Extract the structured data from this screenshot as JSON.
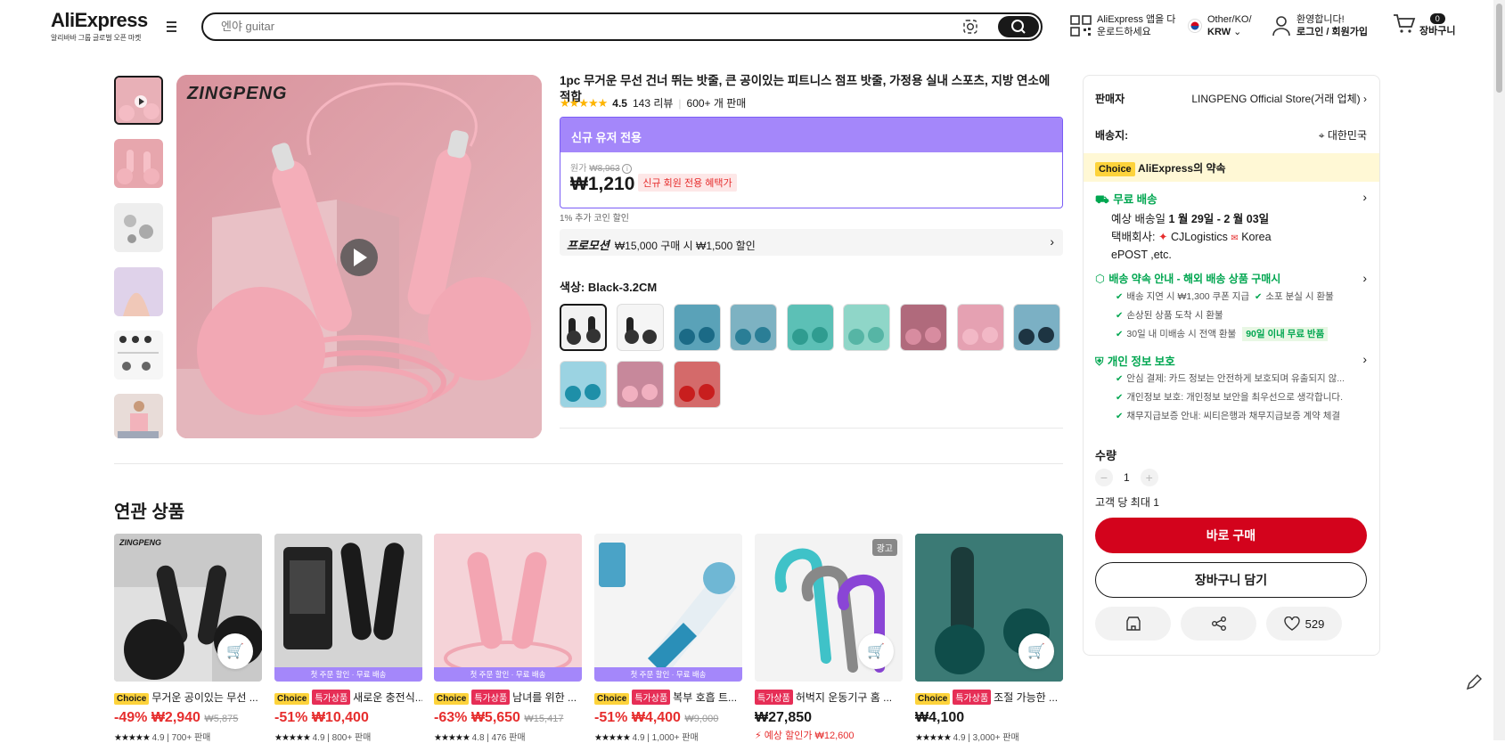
{
  "header": {
    "logo": "AliExpress",
    "logo_sub": "알리바바 그룹 글로벌 오픈 마켓",
    "search_placeholder": "엔야 guitar",
    "app_line1": "AliExpress 앱을 다",
    "app_line2": "운로드하세요",
    "region_line1": "Other/KO/",
    "region_line2": "KRW",
    "account_line1": "환영합니다!",
    "account_line2": "로그인 / 회원가입",
    "cart_count": "0",
    "cart_label": "장바구니"
  },
  "product": {
    "title": "1pc 무거운 무선 건너 뛰는 밧줄, 큰 공이있는 피트니스 점프 밧줄, 가정용 실내 스포츠, 지방 연소에 적합",
    "rating": "4.5",
    "reviews": "143 리뷰",
    "sold": "600+ 개 판매",
    "new_user_banner": "신규 유저 전용",
    "orig_label": "원가",
    "orig_price": "₩8,963",
    "price": "₩1,210",
    "price_tag": "신규 회원 전용 혜택가",
    "coin_note": "1% 추가 코인 할인",
    "promo_label": "프로모션",
    "promo_text": "₩15,000 구매 시 ₩1,500 할인",
    "color_label": "색상:",
    "color_value": "Black-3.2CM",
    "brand_watermark": "ZINGPENG"
  },
  "panel": {
    "seller_label": "판매자",
    "seller_value": "LINGPENG Official Store(거래 업체)",
    "ship_label": "배송지:",
    "ship_value": "대한민국",
    "choice_tag": "Choice",
    "choice_promise": "AliExpress의 약속",
    "free_ship": "무료 배송",
    "eta_prefix": "예상 배송일",
    "eta": "1 월 29일 - 2 월 03일",
    "carrier_label": "택배회사:",
    "carrier1": "CJLogistics",
    "carrier2": "Korea",
    "carrier3": "ePOST ,etc.",
    "promise_title": "배송 약속 안내 - 해외 배송 상품 구매시",
    "promise_items": [
      "배송 지연 시 ₩1,300 쿠폰 지급",
      "소포 분실 시 환불",
      "손상된 상품 도착 시 환불",
      "30일 내 미배송 시 전액 환불"
    ],
    "return_tag": "90일 이내 무료 반품",
    "privacy_title": "개인 정보 보호",
    "privacy_items": [
      "안심 결제: 카드 정보는 안전하게 보호되며 유출되지 않...",
      "개인정보 보호: 개인정보 보안을 최우선으로 생각합니다.",
      "채무지급보증 안내: 씨티은행과 채무지급보증 계약 체결"
    ],
    "qty_label": "수량",
    "qty": "1",
    "limit": "고객 당 최대 1",
    "buy_now": "바로 구매",
    "add_cart": "장바구니 담기",
    "wish_count": "529"
  },
  "related": {
    "title": "연관 상품",
    "items": [
      {
        "choice": "Choice",
        "tag": "",
        "title": "무거운 공이있는 무선 ...",
        "disc": "-49%",
        "price": "₩2,940",
        "orig": "₩5,875",
        "meta": "4.9 | 700+ 판매",
        "banner": "",
        "ad": "",
        "brand": "ZINGPENG"
      },
      {
        "choice": "Choice",
        "tag": "특가상품",
        "title": "새로운 충전식...",
        "disc": "-51%",
        "price": "₩10,400",
        "orig": "",
        "meta": "4.9 | 800+ 판매",
        "banner": "첫 주문 할인 · 무료 배송",
        "ad": "",
        "brand": ""
      },
      {
        "choice": "Choice",
        "tag": "특가상품",
        "title": "남녀를 위한 ...",
        "disc": "-63%",
        "price": "₩5,650",
        "orig": "₩15,417",
        "meta": "4.8 | 476 판매",
        "banner": "첫 주문 할인 · 무료 배송",
        "ad": "",
        "brand": ""
      },
      {
        "choice": "Choice",
        "tag": "특가상품",
        "title": "복부 호흡 트...",
        "disc": "-51%",
        "price": "₩4,400",
        "orig": "₩9,000",
        "meta": "4.9 | 1,000+ 판매",
        "banner": "첫 주문 할인 · 무료 배송",
        "ad": "",
        "brand": ""
      },
      {
        "choice": "",
        "tag": "특가상품",
        "title": "허벅지 운동기구 홈 ...",
        "disc": "",
        "price": "₩27,850",
        "orig": "",
        "meta": "",
        "banner": "",
        "ad": "광고",
        "brand": "",
        "sale": "예상 할인가 ₩12,600"
      },
      {
        "choice": "Choice",
        "tag": "특가상품",
        "title": "조절 가능한 ...",
        "disc": "",
        "price": "₩4,100",
        "orig": "",
        "meta": "4.9 | 3,000+ 판매",
        "banner": "",
        "ad": "",
        "brand": ""
      }
    ]
  }
}
